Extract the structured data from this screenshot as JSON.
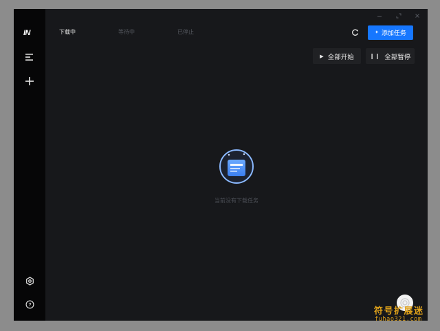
{
  "sidebar": {
    "logo": "IN",
    "icons": [
      "menu-icon",
      "plus-icon",
      "settings-icon",
      "help-icon"
    ]
  },
  "window_controls": [
    "minimize-icon",
    "maximize-icon",
    "close-icon"
  ],
  "tabs": [
    {
      "label": "下载中",
      "active": true
    },
    {
      "label": "等待中",
      "active": false
    },
    {
      "label": "已停止",
      "active": false
    }
  ],
  "toolbar": {
    "add_task_label": "添加任务",
    "start_all_label": "全部开始",
    "pause_all_label": "全部暂停"
  },
  "empty_state": {
    "message": "当前没有下载任务"
  },
  "watermark": {
    "title": "符号扩展迷",
    "domain": "fuhao321.com"
  },
  "colors": {
    "accent": "#1677ff",
    "background": "#17181b",
    "sidebar": "#060607",
    "watermark": "#e0a21a"
  }
}
